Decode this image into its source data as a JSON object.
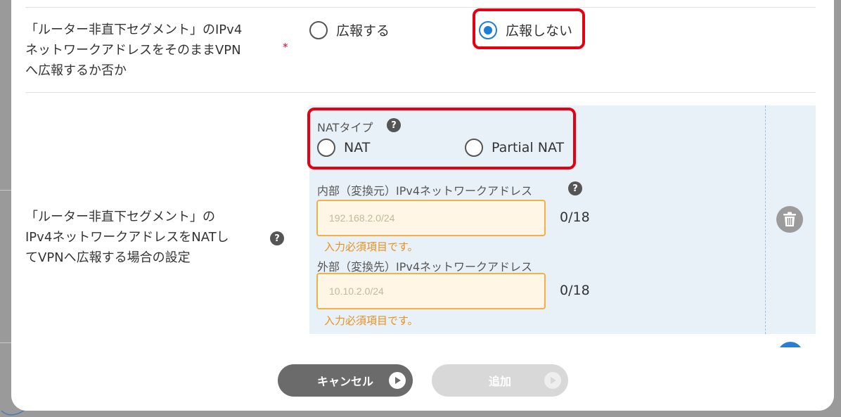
{
  "row1": {
    "label_lines": [
      "「ルーター非直下セグメント」のIPv4",
      "ネットワークアドレスをそのままVPN",
      "へ広報するか否か"
    ],
    "required_mark": "*",
    "options": [
      {
        "label": "広報する",
        "checked": false
      },
      {
        "label": "広報しない",
        "checked": true
      }
    ]
  },
  "row2": {
    "label_lines": [
      "「ルーター非直下セグメント」の",
      "IPv4ネットワークアドレスをNATし",
      "てVPNへ広報する場合の設定"
    ],
    "help_icon": "?",
    "nat_type": {
      "label": "NATタイプ",
      "help_icon": "?",
      "options": [
        {
          "label": "NAT",
          "checked": false
        },
        {
          "label": "Partial NAT",
          "checked": false
        }
      ]
    },
    "internal": {
      "label": "内部（変換元）IPv4ネットワークアドレス",
      "help_icon": "?",
      "placeholder": "192.168.2.0/24",
      "counter": "0/18",
      "error": "入力必須項目です。"
    },
    "external": {
      "label": "外部（変換先）IPv4ネットワークアドレス",
      "placeholder": "10.10.2.0/24",
      "counter": "0/18",
      "error": "入力必須項目です。"
    }
  },
  "footer": {
    "cancel_label": "キャンセル",
    "add_label": "追加"
  },
  "colors": {
    "accent": "#1c7ed6",
    "highlight": "#e60012",
    "warning": "#e8911e",
    "panel": "#e9f1f8"
  }
}
